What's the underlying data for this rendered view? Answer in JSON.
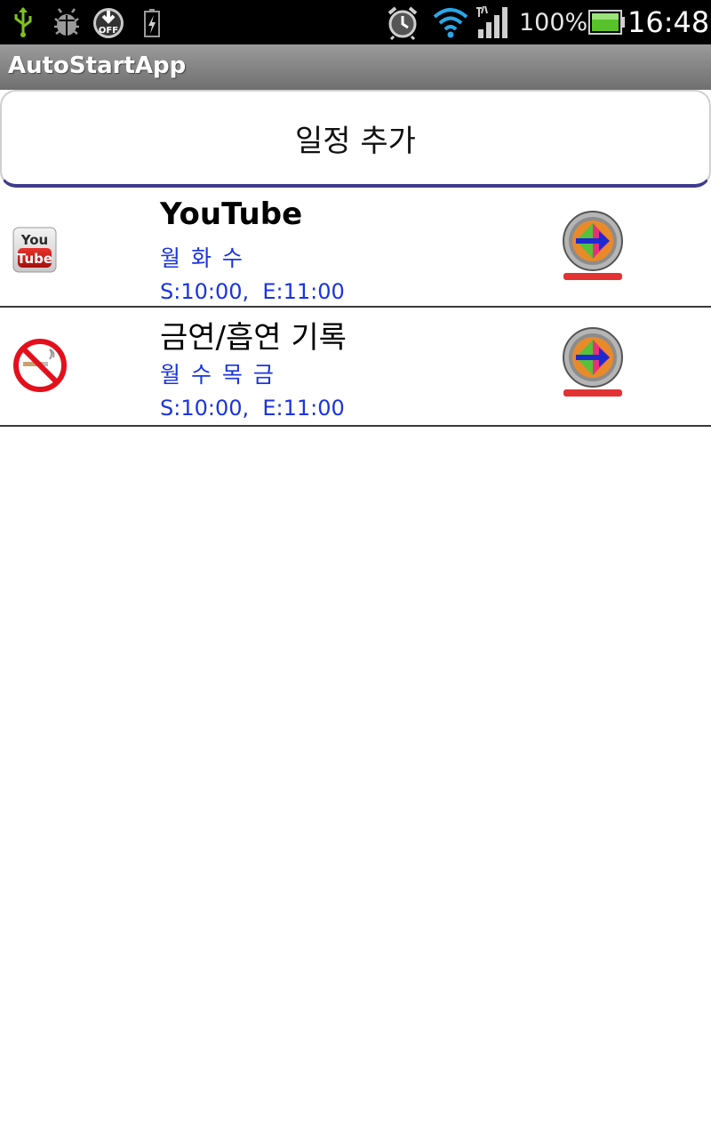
{
  "status_bar": {
    "icons_left": [
      "usb-icon",
      "debug-bug-icon",
      "download-off-icon",
      "battery-charging-icon"
    ],
    "off_badge": "OFF",
    "icons_right": [
      "alarm-clock-icon",
      "wifi-icon",
      "signal-icon",
      "battery-icon"
    ],
    "battery_percent": "100%",
    "time": "16:48"
  },
  "app": {
    "title": "AutoStartApp"
  },
  "add_button": {
    "label": "일정 추가"
  },
  "schedules": [
    {
      "title": "YouTube",
      "icon": "youtube-icon",
      "days": "월 화 수",
      "time": "S:10:00,  E:11:00"
    },
    {
      "title": "금연/흡연 기록",
      "icon": "no-smoking-icon",
      "days": "월 수 목 금",
      "time": "S:10:00,  E:11:00"
    }
  ],
  "colors": {
    "accent_blue": "#1a34e0",
    "button_underline": "#3d3c8c",
    "status_green": "#7fc31b"
  }
}
